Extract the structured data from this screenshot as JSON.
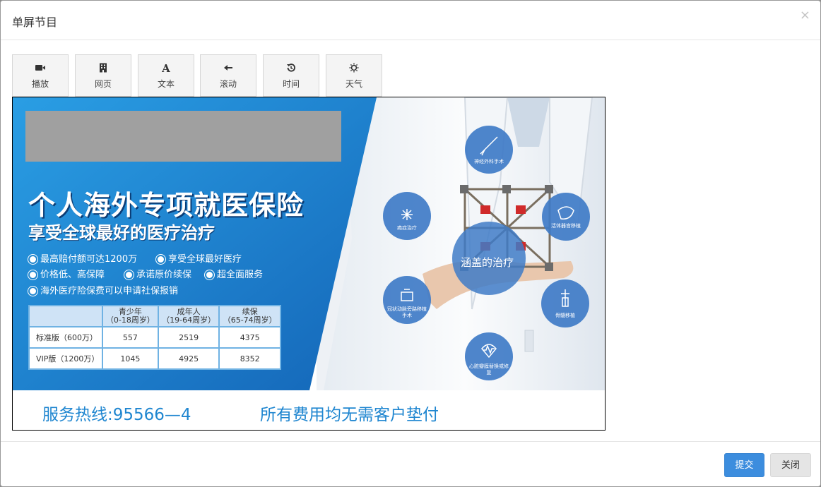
{
  "dialog": {
    "title": "单屏节目",
    "close_glyph": "×"
  },
  "toolbar": {
    "items": [
      {
        "label": "播放",
        "icon": "video-camera-icon"
      },
      {
        "label": "网页",
        "icon": "building-icon"
      },
      {
        "label": "文本",
        "icon": "font-icon"
      },
      {
        "label": "滚动",
        "icon": "arrow-left-icon"
      },
      {
        "label": "时间",
        "icon": "history-icon"
      },
      {
        "label": "天气",
        "icon": "sun-icon"
      }
    ]
  },
  "ad": {
    "headline": "个人海外专项就医保险",
    "subhead": "享受全球最好的医疗治疗",
    "bullets": [
      "最高赔付额可达1200万",
      "享受全球最好医疗",
      "价格低、高保障",
      "承诺原价续保",
      "超全面服务",
      "海外医疗险保费可以申请社保报销"
    ],
    "table": {
      "headers": [
        {
          "line1": "",
          "line2": ""
        },
        {
          "line1": "青少年",
          "line2": "（0-18周岁）"
        },
        {
          "line1": "成年人",
          "line2": "（19-64周岁）"
        },
        {
          "line1": "续保",
          "line2": "（65-74周岁）"
        }
      ],
      "rows": [
        [
          "标准版（600万）",
          "557",
          "2519",
          "4375"
        ],
        [
          "VIP版（1200万）",
          "1045",
          "4925",
          "8352"
        ]
      ]
    },
    "hotline": "服务热线:95566—4",
    "slogan": "所有费用均无需客户垫付",
    "center_label": "涵盖的治疗",
    "treatments": [
      "神经外科手术",
      "癌症治疗",
      "活体器官移植",
      "冠状动脉旁路移植手术",
      "骨髓移植",
      "心脏瓣膜替换或修复"
    ],
    "colors": {
      "blue": "#1f86d0",
      "dark_blue": "#0b3c75",
      "circle_blue": "#3f7bc7",
      "placeholder_gray": "#a0a0a0"
    }
  },
  "footer": {
    "submit_label": "提交",
    "close_label": "关闭"
  }
}
